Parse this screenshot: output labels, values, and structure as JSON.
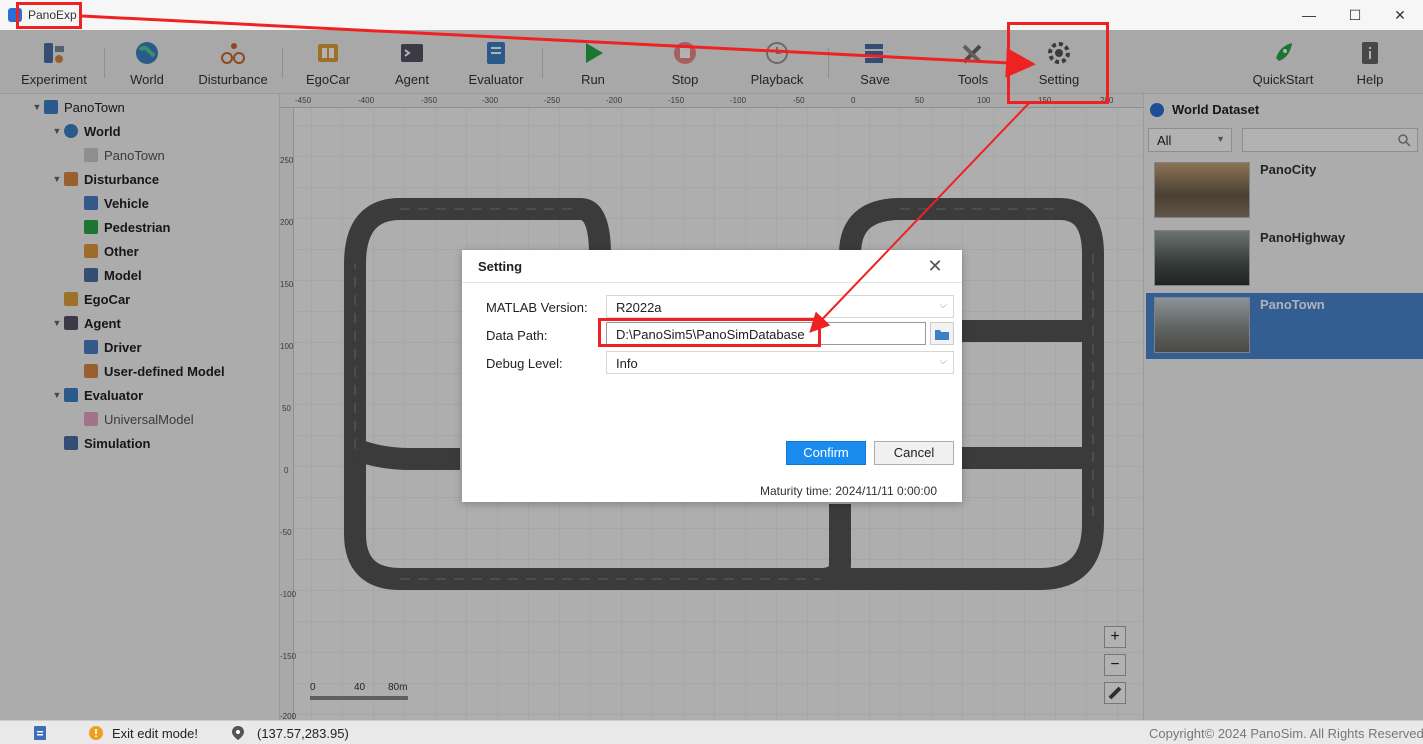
{
  "title_bar": {
    "app_name": "PanoExp",
    "minimize": "—",
    "maximize": "☐",
    "close": "✕"
  },
  "toolbar": {
    "items": [
      {
        "label": "Experiment"
      },
      {
        "label": "World"
      },
      {
        "label": "Disturbance"
      },
      {
        "label": "EgoCar"
      },
      {
        "label": "Agent"
      },
      {
        "label": "Evaluator"
      },
      {
        "label": "Run"
      },
      {
        "label": "Stop"
      },
      {
        "label": "Playback"
      },
      {
        "label": "Save"
      },
      {
        "label": "Tools"
      },
      {
        "label": "Setting"
      },
      {
        "label": "QuickStart"
      },
      {
        "label": "Help"
      }
    ]
  },
  "tree": {
    "root": "PanoTown",
    "items": [
      {
        "label": "World"
      },
      {
        "label": "PanoTown"
      },
      {
        "label": "Disturbance"
      },
      {
        "label": "Vehicle"
      },
      {
        "label": "Pedestrian"
      },
      {
        "label": "Other"
      },
      {
        "label": "Model"
      },
      {
        "label": "EgoCar"
      },
      {
        "label": "Agent"
      },
      {
        "label": "Driver"
      },
      {
        "label": "User-defined Model"
      },
      {
        "label": "Evaluator"
      },
      {
        "label": "UniversalModel"
      },
      {
        "label": "Simulation"
      }
    ]
  },
  "canvas": {
    "ruler_x": [
      "-450",
      "-400",
      "-350",
      "-300",
      "-250",
      "-200",
      "-150",
      "-100",
      "-50",
      "0",
      "50",
      "100",
      "150",
      "200"
    ],
    "ruler_y": [
      "250",
      "200",
      "150",
      "100",
      "50",
      "0",
      "-50",
      "-100",
      "-150",
      "-200"
    ],
    "scale": {
      "a": "0",
      "b": "40",
      "c": "80m"
    },
    "zoom_in": "+",
    "zoom_out": "−"
  },
  "world_dataset": {
    "title": "World Dataset",
    "filter": "All",
    "cards": [
      {
        "name": "PanoCity"
      },
      {
        "name": "PanoHighway"
      },
      {
        "name": "PanoTown"
      }
    ],
    "selected_card_color": "#4a87d4"
  },
  "dialog": {
    "title": "Setting",
    "close": "✕",
    "matlab_label": "MATLAB Version:",
    "matlab_value": "R2022a",
    "path_label": "Data Path:",
    "path_value": "D:\\PanoSim5\\PanoSimDatabase",
    "debug_label": "Debug Level:",
    "debug_value": "Info",
    "confirm": "Confirm",
    "cancel": "Cancel",
    "maturity": "Maturity time:  2024/11/11 0:00:00"
  },
  "status_bar": {
    "message": "Exit edit mode!",
    "coords": "(137.57,283.95)",
    "copyright": "Copyright© 2024 PanoSim. All Rights Reserved"
  },
  "colors": {
    "accent": "#1a8cf0",
    "annotation": "#ee2222"
  }
}
